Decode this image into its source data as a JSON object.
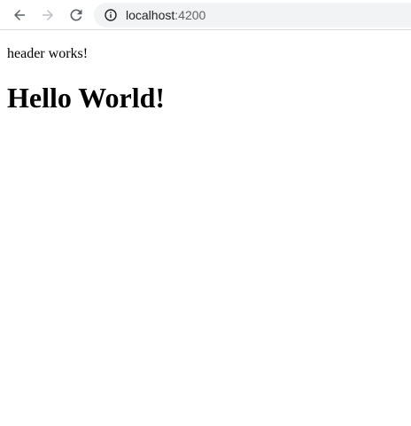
{
  "browser": {
    "url_host": "localhost",
    "url_port": ":4200",
    "icons": {
      "back": "arrow-left-icon",
      "forward": "arrow-right-icon",
      "reload": "reload-icon",
      "site_info": "info-icon"
    },
    "colors": {
      "omnibox_bg": "#f1f3f4",
      "icon_active": "#5f6368",
      "icon_disabled": "#bdc1c6"
    }
  },
  "page": {
    "header_text": "header works!",
    "heading": "Hello World!"
  }
}
